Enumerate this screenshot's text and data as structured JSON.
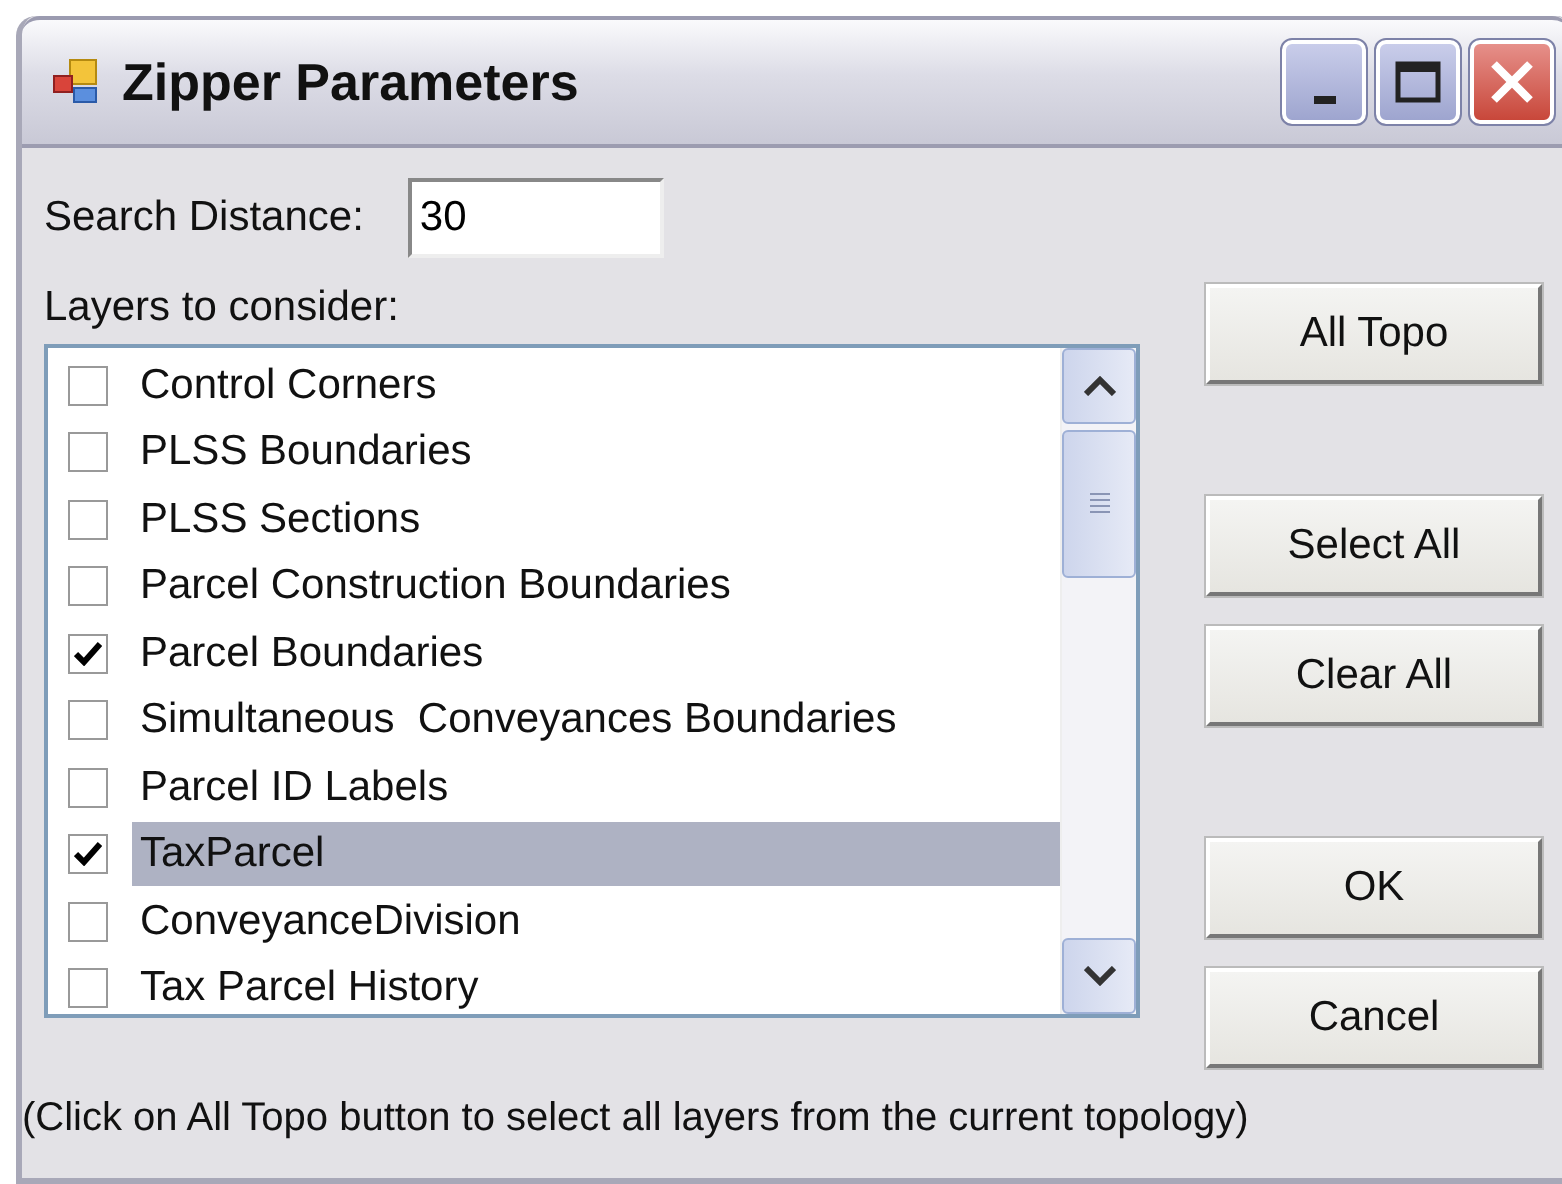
{
  "window": {
    "title": "Zipper Parameters"
  },
  "search_distance": {
    "label": "Search Distance:",
    "value": "30"
  },
  "layers": {
    "label": "Layers to consider:",
    "items": [
      {
        "name": "Control Corners",
        "checked": false,
        "selected": false
      },
      {
        "name": "PLSS Boundaries",
        "checked": false,
        "selected": false
      },
      {
        "name": "PLSS Sections",
        "checked": false,
        "selected": false
      },
      {
        "name": "Parcel Construction Boundaries",
        "checked": false,
        "selected": false
      },
      {
        "name": "Parcel Boundaries",
        "checked": true,
        "selected": false
      },
      {
        "name": "Simultaneous  Conveyances Boundaries",
        "checked": false,
        "selected": false
      },
      {
        "name": "Parcel ID Labels",
        "checked": false,
        "selected": false
      },
      {
        "name": "TaxParcel",
        "checked": true,
        "selected": true
      },
      {
        "name": "ConveyanceDivision",
        "checked": false,
        "selected": false
      },
      {
        "name": "Tax Parcel History",
        "checked": false,
        "selected": false
      }
    ]
  },
  "buttons": [
    {
      "label": "All Topo"
    },
    {
      "label": "Select All"
    },
    {
      "label": "Clear All"
    },
    {
      "label": "OK"
    },
    {
      "label": "Cancel"
    }
  ],
  "hint": "(Click on All Topo button to select all layers from the current topology)"
}
